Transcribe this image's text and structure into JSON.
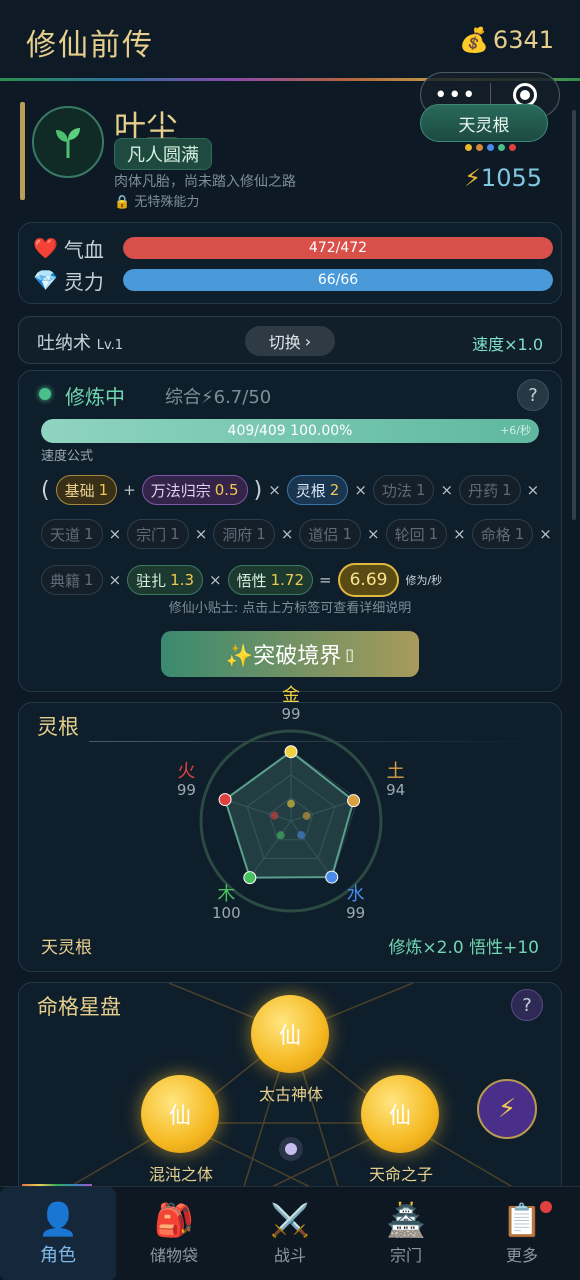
{
  "header": {
    "title": "修仙前传",
    "coins": "6341"
  },
  "capsule": {
    "more": "•••"
  },
  "profile": {
    "name": "叶尘",
    "realm": "凡人圆满",
    "desc": "肉体凡胎，尚未踏入修仙之路",
    "ability": "无特殊能力",
    "root_tag": "天灵根",
    "root_dots": [
      "#e8b830",
      "#d08a3a",
      "#4a8ae8",
      "#49c08a",
      "#e04040"
    ],
    "power": "1055"
  },
  "stats": {
    "hp": {
      "label": "气血",
      "text": "472/472",
      "fraction": 1.0,
      "color": "#d9504a"
    },
    "mp": {
      "label": "灵力",
      "text": "66/66",
      "fraction": 1.0,
      "color": "#4a9ad9"
    }
  },
  "technique": {
    "name": "吐纳术",
    "level": "Lv.1",
    "switch": "切换",
    "speed": "速度×1.0"
  },
  "cultivation": {
    "status": "修炼中",
    "overall": "综合⚡6.7/50",
    "progress_text": "409/409  100.00%",
    "progress_rate": "+6/秒",
    "progress_fraction": 1.0,
    "formula_label": "速度公式",
    "chips": {
      "base": {
        "label": "基础",
        "value": "1"
      },
      "wanfa": {
        "label": "万法归宗",
        "value": "0.5"
      },
      "lingen": {
        "label": "灵根",
        "value": "2"
      },
      "gongfa": {
        "label": "功法",
        "value": "1"
      },
      "danyao": {
        "label": "丹药",
        "value": "1"
      },
      "tiandao": {
        "label": "天道",
        "value": "1"
      },
      "zongmen": {
        "label": "宗门",
        "value": "1"
      },
      "dongfu": {
        "label": "洞府",
        "value": "1"
      },
      "daolv": {
        "label": "道侣",
        "value": "1"
      },
      "lunhui": {
        "label": "轮回",
        "value": "1"
      },
      "mingge": {
        "label": "命格",
        "value": "1"
      },
      "dianji": {
        "label": "典籍",
        "value": "1"
      },
      "zhuzha": {
        "label": "驻扎",
        "value": "1.3"
      },
      "wuxing": {
        "label": "悟性",
        "value": "1.72"
      }
    },
    "result": "6.69",
    "result_unit": "修为/秒",
    "tip": "修仙小贴士: 点击上方标签可查看详细说明",
    "breakthrough": "✨突破境界"
  },
  "spirit_root": {
    "title": "灵根",
    "elements": [
      {
        "name": "金",
        "value": "99",
        "color": "#f0d040"
      },
      {
        "name": "土",
        "value": "94",
        "color": "#d8a040"
      },
      {
        "name": "水",
        "value": "99",
        "color": "#4a8ae8"
      },
      {
        "name": "木",
        "value": "100",
        "color": "#49c060"
      },
      {
        "name": "火",
        "value": "99",
        "color": "#e04040"
      }
    ],
    "name": "天灵根",
    "bonus": "修炼×2.0  悟性+10"
  },
  "destiny": {
    "title": "命格星盘",
    "stars": [
      {
        "glyph": "仙",
        "label": "太古神体"
      },
      {
        "glyph": "仙",
        "label": "混沌之体"
      },
      {
        "glyph": "仙",
        "label": "天命之子"
      }
    ]
  },
  "nav": [
    {
      "label": "角色",
      "icon": "👤"
    },
    {
      "label": "储物袋",
      "icon": "🎒"
    },
    {
      "label": "战斗",
      "icon": "⚔️"
    },
    {
      "label": "宗门",
      "icon": "🏯"
    },
    {
      "label": "更多",
      "icon": "📋"
    }
  ]
}
